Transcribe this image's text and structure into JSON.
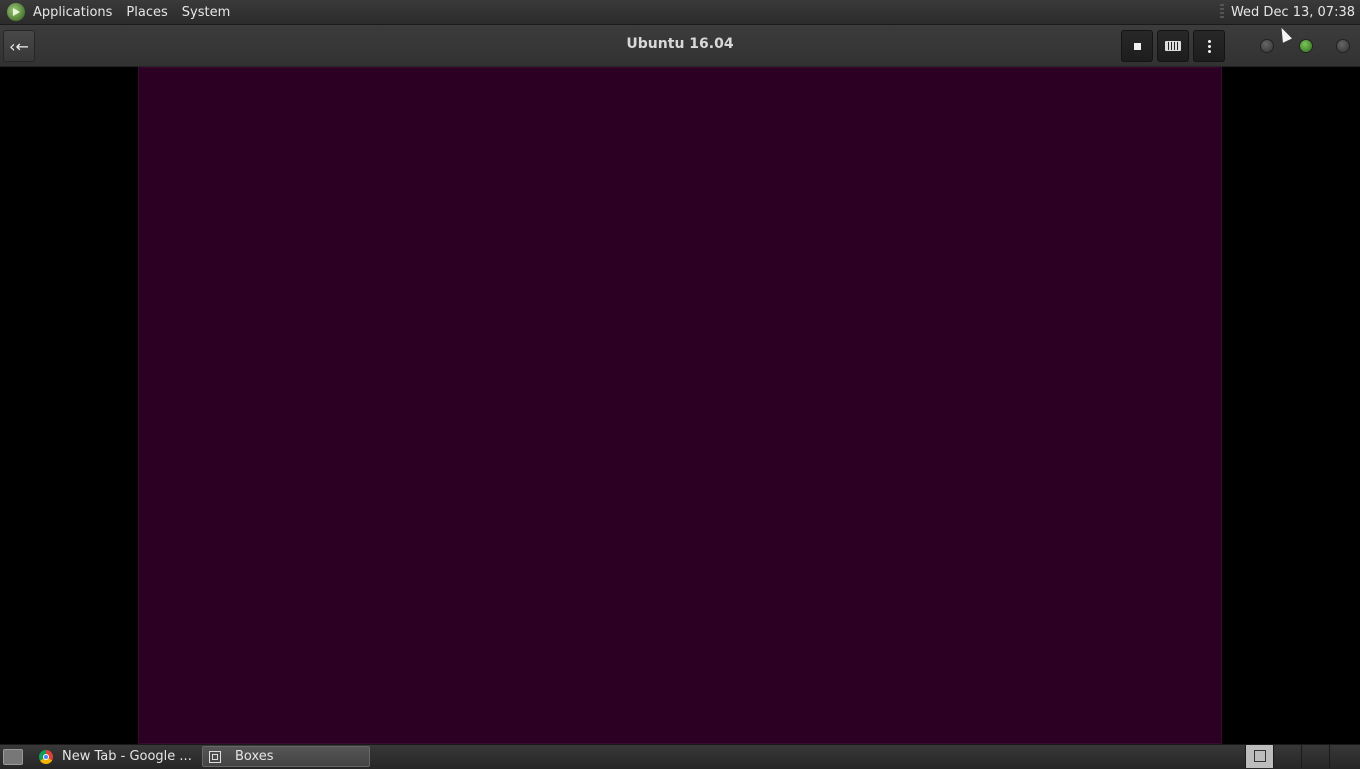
{
  "top_panel": {
    "menus": [
      "Applications",
      "Places",
      "System"
    ],
    "clock": "Wed Dec 13, 07:38"
  },
  "header_bar": {
    "title": "Ubuntu 16.04",
    "buttons": [
      "back-icon",
      "stop-icon",
      "keyboard-icon",
      "menu-kebab-icon"
    ]
  },
  "vm_display": {
    "background_color": "#2c0022"
  },
  "taskbar": {
    "tasks": [
      {
        "label": "New Tab - Google ...",
        "icon": "chrome-icon",
        "active": false
      },
      {
        "label": "Boxes",
        "icon": "boxes-icon",
        "active": true
      }
    ]
  }
}
